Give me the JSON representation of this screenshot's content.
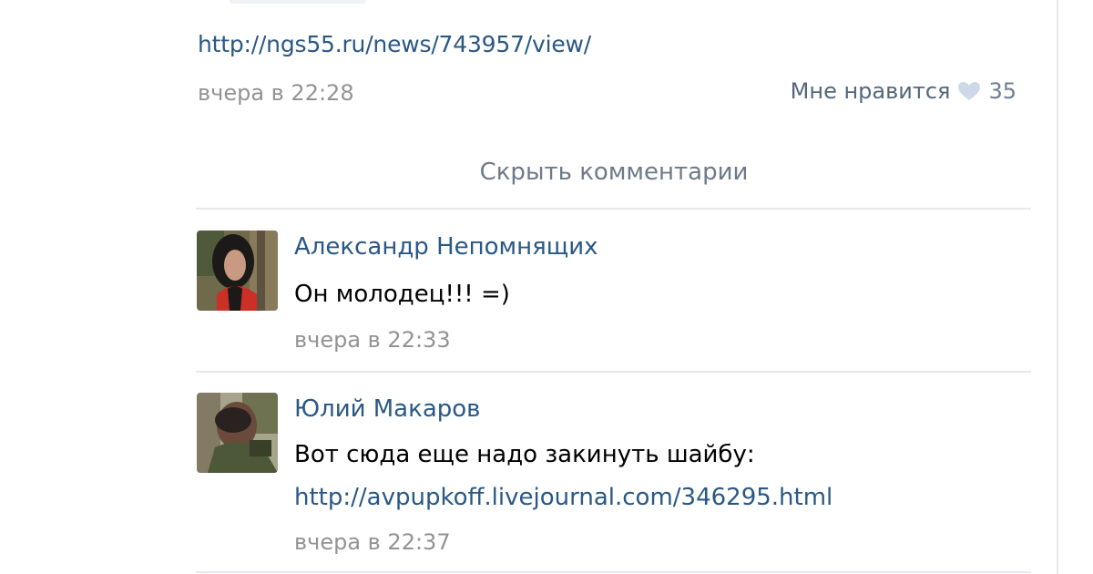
{
  "post": {
    "link": "http://ngs55.ru/news/743957/view/",
    "date": "вчера в 22:28",
    "likes": {
      "label": "Мне нравится",
      "count": "35",
      "icon": "heart-icon"
    }
  },
  "comments_toggle": "Скрыть комментарии",
  "comments": [
    {
      "author": "Александр Непомнящих",
      "text": "Он молодец!!! =)",
      "date": "вчера в 22:33"
    },
    {
      "author": "Юлий Макаров",
      "text": "Вот сюда еще надо закинуть шайбу:",
      "link": "http://avpupkoff.livejournal.com/346295.html",
      "date": "вчера в 22:37"
    }
  ],
  "colors": {
    "link": "#2a5885",
    "meta": "#939393",
    "divider": "#e7e8ec",
    "heart": "#cdd9e6"
  }
}
